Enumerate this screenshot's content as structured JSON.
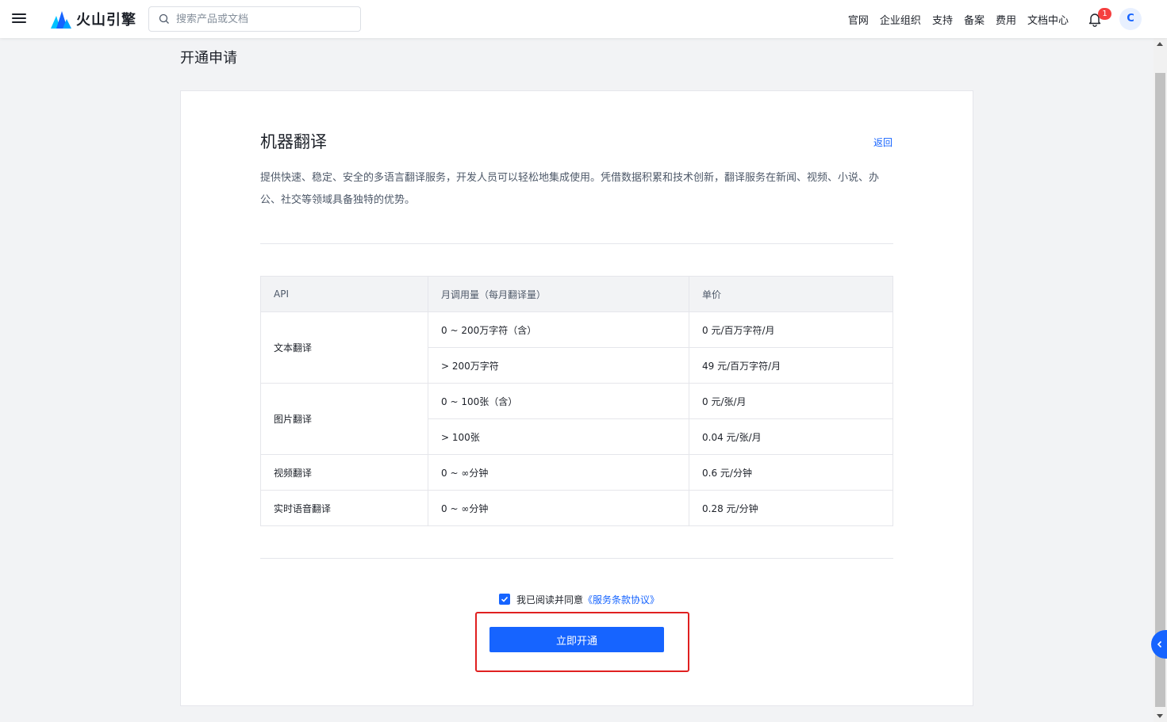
{
  "header": {
    "logo_text": "火山引擎",
    "search_placeholder": "搜索产品或文档",
    "nav": [
      "官网",
      "企业组织",
      "支持",
      "备案",
      "费用",
      "文档中心"
    ],
    "notification_count": "1",
    "avatar_letter": "C"
  },
  "page": {
    "title": "开通申请"
  },
  "card": {
    "title": "机器翻译",
    "back_label": "返回",
    "description": "提供快速、稳定、安全的多语言翻译服务，开发人员可以轻松地集成使用。凭借数据积累和技术创新，翻译服务在新闻、视频、小说、办公、社交等领域具备独特的优势。"
  },
  "table": {
    "headers": [
      "API",
      "月调用量（每月翻译量）",
      "单价"
    ],
    "rows": {
      "text": {
        "api": "文本翻译",
        "tiers": [
          {
            "usage": "0 ~ 200万字符（含）",
            "price": "0 元/百万字符/月"
          },
          {
            "usage": "> 200万字符",
            "price": "49 元/百万字符/月"
          }
        ]
      },
      "image": {
        "api": "图片翻译",
        "tiers": [
          {
            "usage": "0 ~ 100张（含）",
            "price": "0 元/张/月"
          },
          {
            "usage": "> 100张",
            "price": "0.04 元/张/月"
          }
        ]
      },
      "video": {
        "api": "视频翻译",
        "usage": "0 ~ ∞分钟",
        "price": "0.6 元/分钟"
      },
      "voice": {
        "api": "实时语音翻译",
        "usage": "0 ~ ∞分钟",
        "price": "0.28 元/分钟"
      }
    }
  },
  "agreement": {
    "checked": true,
    "text": "我已阅读并同意",
    "link": "《服务条款协议》"
  },
  "action": {
    "open_label": "立即开通"
  },
  "colors": {
    "primary": "#1664ff",
    "highlight": "#e02020",
    "badge": "#f53f3f"
  }
}
